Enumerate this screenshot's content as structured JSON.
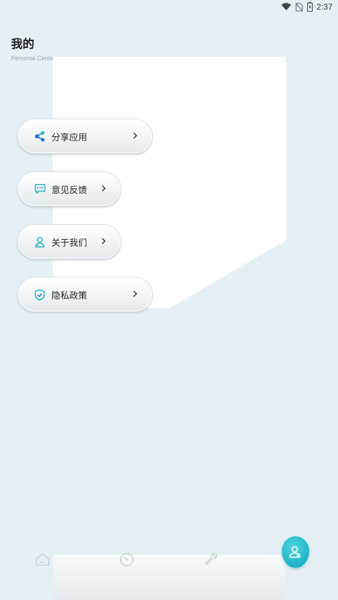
{
  "status_bar": {
    "time": "2:37",
    "icons": [
      "wifi-icon",
      "no-sim-icon",
      "battery-charging-icon"
    ]
  },
  "header": {
    "title": "我的",
    "subtitle": "Personal Center"
  },
  "menu": {
    "items": [
      {
        "label": "分享应用",
        "icon": "share-icon"
      },
      {
        "label": "意见反馈",
        "icon": "feedback-icon"
      },
      {
        "label": "关于我们",
        "icon": "about-user-icon"
      },
      {
        "label": "隐私政策",
        "icon": "shield-check-icon"
      }
    ]
  },
  "bottom_nav": {
    "items": [
      {
        "icon": "home-icon",
        "active": false
      },
      {
        "icon": "speedometer-icon",
        "active": false
      },
      {
        "icon": "wrench-icon",
        "active": false
      },
      {
        "icon": "user-icon",
        "active": true
      }
    ]
  },
  "colors": {
    "background": "#e6f0f4",
    "accent": "#1fb3c8",
    "icon_blue": "#2a6fd6",
    "icon_cyan": "#26b5c7"
  }
}
